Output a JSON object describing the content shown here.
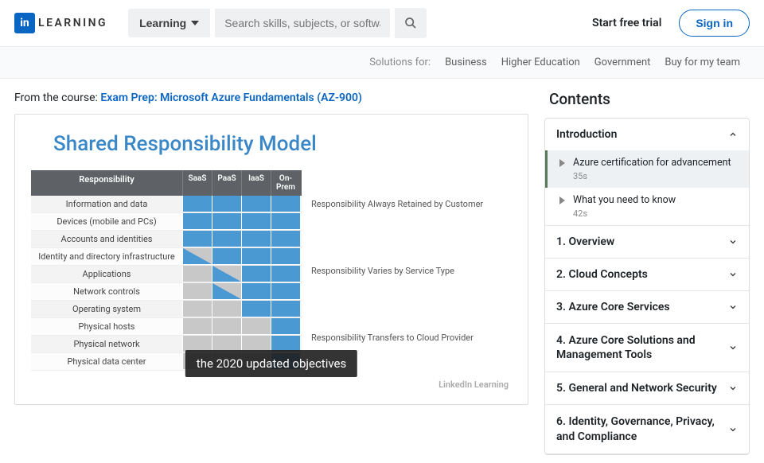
{
  "header": {
    "logo_in": "in",
    "logo_learning": "LEARNING",
    "learning_dd": "Learning",
    "search_placeholder": "Search skills, subjects, or software",
    "trial": "Start free trial",
    "signin": "Sign in"
  },
  "subnav": {
    "label": "Solutions for:",
    "items": [
      "Business",
      "Higher Education",
      "Government",
      "Buy for my team"
    ]
  },
  "from_course": {
    "prefix": "From the course: ",
    "link": "Exam Prep: Microsoft Azure Fundamentals (AZ-900)"
  },
  "video": {
    "title": "Shared Responsibility Model",
    "caption": "the 2020 updated objectives",
    "watermark": "LinkedIn Learning",
    "table": {
      "header_resp": "Responsibility",
      "header_cols": [
        "SaaS",
        "PaaS",
        "IaaS",
        "On-Prem"
      ],
      "rows": [
        "Information and data",
        "Devices (mobile and PCs)",
        "Accounts and identities",
        "Identity and directory infrastructure",
        "Applications",
        "Network controls",
        "Operating system",
        "Physical hosts",
        "Physical network",
        "Physical data center"
      ],
      "notes": [
        "Responsibility Always Retained by Customer",
        "Responsibility Varies by Service Type",
        "Responsibility Transfers to Cloud Provider"
      ]
    }
  },
  "contents": {
    "title": "Contents",
    "expanded": {
      "title": "Introduction",
      "lessons": [
        {
          "title": "Azure certification for advancement",
          "dur": "35s",
          "active": true
        },
        {
          "title": "What you need to know",
          "dur": "42s",
          "active": false
        }
      ]
    },
    "collapsed": [
      "1. Overview",
      "2. Cloud Concepts",
      "3. Azure Core Services",
      "4. Azure Core Solutions and Management Tools",
      "5. General and Network Security",
      "6. Identity, Governance, Privacy, and Compliance"
    ]
  }
}
